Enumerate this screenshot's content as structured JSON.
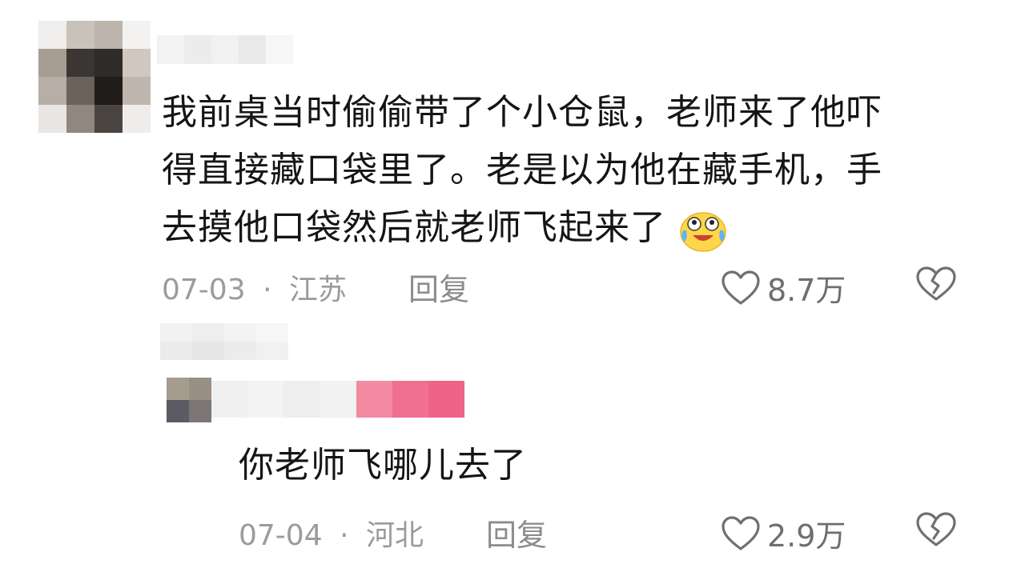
{
  "comments": [
    {
      "text_lines": [
        "我前桌当时偷偷带了个小仓鼠，老师来了他吓",
        "得直接藏口袋里了。老是以为他在藏手机，手",
        "去摸他口袋然后就老师飞起来了"
      ],
      "emoji": "laughing-tears-emoji",
      "date": "07-03",
      "separator": "·",
      "location": "江苏",
      "reply_label": "回复",
      "likes": "8.7万"
    },
    {
      "text_lines": [
        "你老师飞哪儿去了"
      ],
      "date": "07-04",
      "separator": "·",
      "location": "河北",
      "reply_label": "回复",
      "likes": "2.9万"
    }
  ],
  "icons": {
    "like": "heart-outline-icon",
    "dislike": "broken-heart-icon"
  },
  "colors": {
    "text": "#151515",
    "meta": "#9b9b9b",
    "icon": "#707070",
    "censor_pink": "#f06a8a"
  }
}
